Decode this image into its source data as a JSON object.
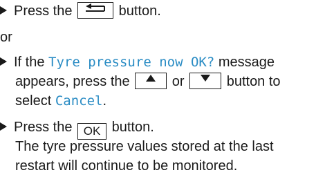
{
  "steps": {
    "s1": {
      "pre": "Press the",
      "post": "button."
    },
    "or": "or",
    "s2": {
      "line1_pre": "If the",
      "display_msg": "Tyre pressure now OK?",
      "line1_post": "message",
      "line2_pre": "appears, press the",
      "line2_mid": "or",
      "line2_post": "button to",
      "line3_pre": "select",
      "display_cancel": "Cancel",
      "line3_post": "."
    },
    "s3": {
      "pre": "Press the",
      "key_label": "OK",
      "post": "button.",
      "result_line1": "The tyre pressure values stored at the last",
      "result_line2": "restart will continue to be monitored."
    }
  },
  "icons": {
    "back": "back-arrow-icon",
    "up": "triangle-up-icon",
    "down": "triangle-down-icon",
    "bullet": "triangle-right-icon"
  },
  "colors": {
    "display_text": "#2a8cc4",
    "text": "#1a1a1a"
  }
}
